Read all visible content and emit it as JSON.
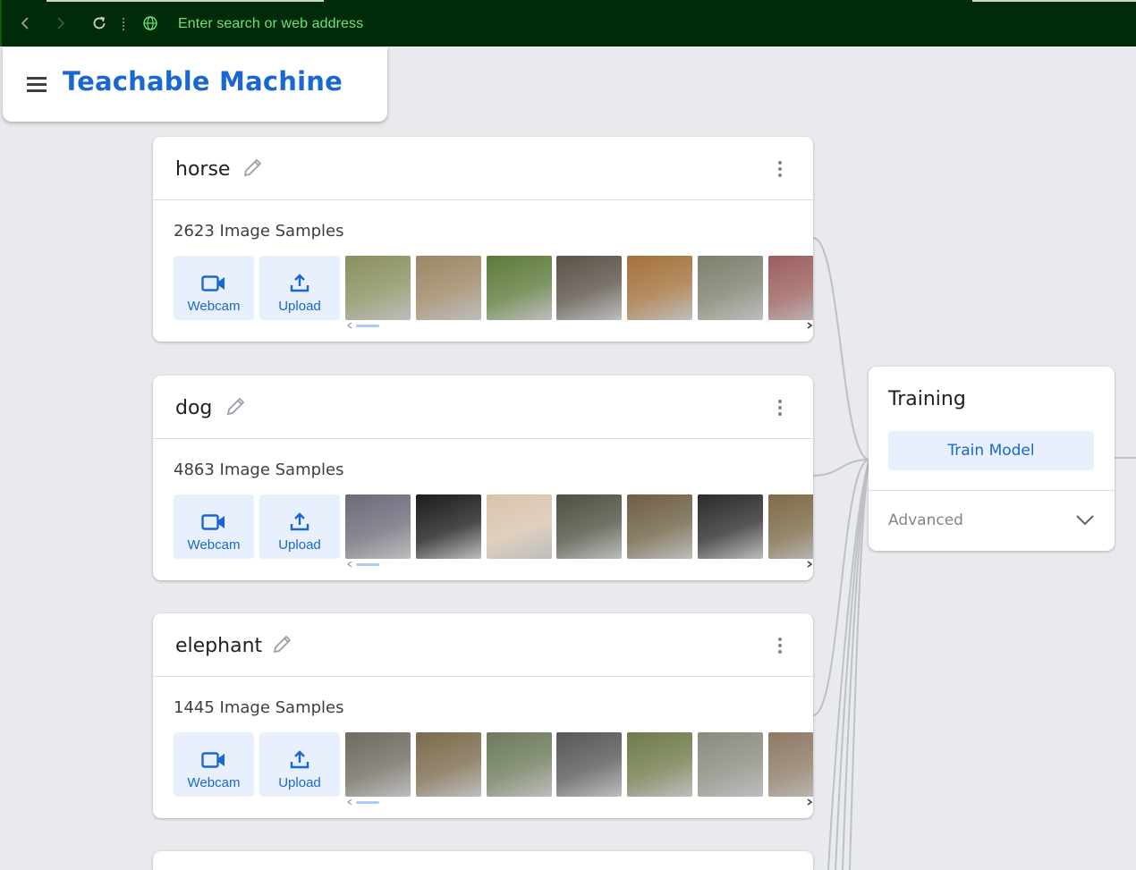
{
  "browser": {
    "address_placeholder": "Enter search or web address"
  },
  "app": {
    "title": "Teachable Machine"
  },
  "classes": [
    {
      "name": "horse",
      "samples_label": "2623 Image Samples",
      "webcam_label": "Webcam",
      "upload_label": "Upload",
      "thumb_colors": [
        "#8a8f5e",
        "#9c8664",
        "#5d7a3a",
        "#5b5248",
        "#a3713b",
        "#7c806c",
        "#9b5f5e"
      ]
    },
    {
      "name": "dog",
      "samples_label": "4863 Image Samples",
      "webcam_label": "Webcam",
      "upload_label": "Upload",
      "thumb_colors": [
        "#6b6a78",
        "#1c1c1c",
        "#d8c4ad",
        "#4d5141",
        "#6d5f43",
        "#2d2a2a",
        "#7d6a48"
      ]
    },
    {
      "name": "elephant",
      "samples_label": "1445 Image Samples",
      "webcam_label": "Webcam",
      "upload_label": "Upload",
      "thumb_colors": [
        "#6f6a5f",
        "#7b6a4c",
        "#6c7a5a",
        "#565858",
        "#6f7a4a",
        "#8a8a80",
        "#8d7a65"
      ]
    }
  ],
  "training": {
    "title": "Training",
    "train_button": "Train Model",
    "advanced_label": "Advanced"
  },
  "colors": {
    "accent": "#1967d2",
    "button_bg": "#e8f0fe",
    "chrome_bg": "#002b08",
    "address_text": "#6ee07a"
  }
}
